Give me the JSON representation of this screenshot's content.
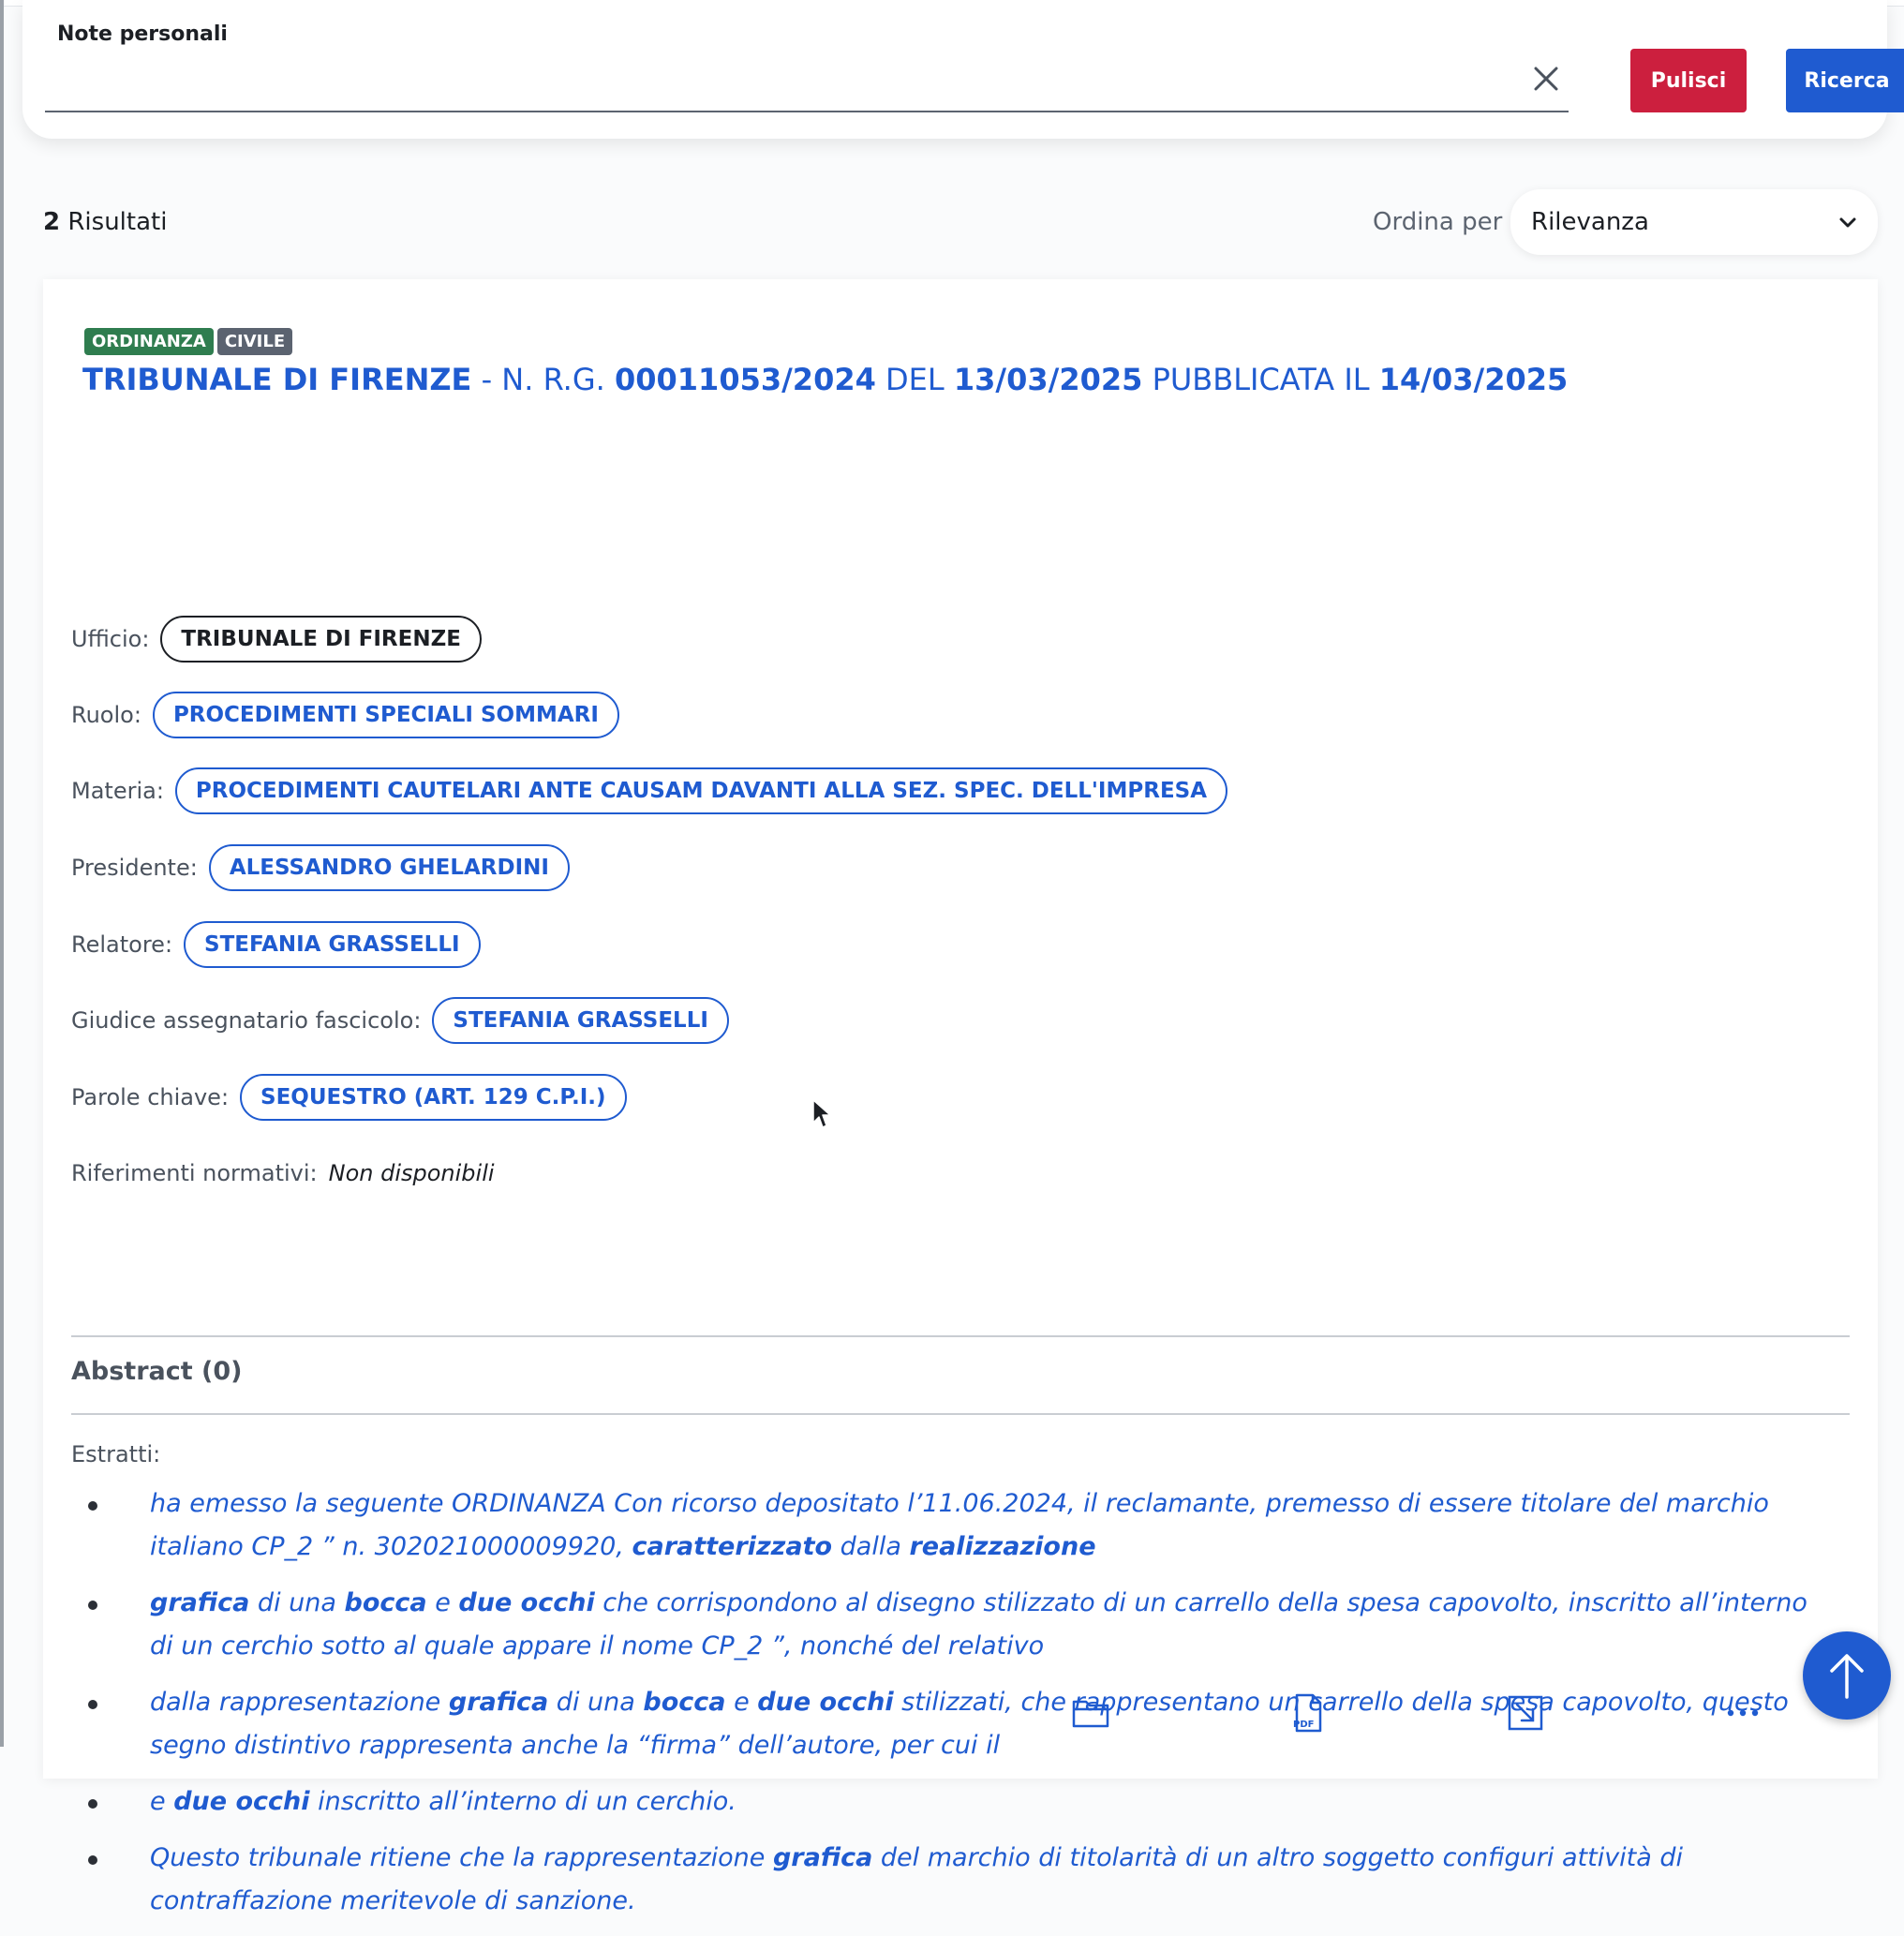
{
  "search": {
    "note_label": "Note personali",
    "note_value": "",
    "clear_label": "Pulisci",
    "search_label": "Ricerca"
  },
  "results": {
    "count": "2",
    "count_label": "Risultati",
    "sort_label": "Ordina per",
    "sort_value": "Rilevanza"
  },
  "colors": {
    "primary": "#1f5bd0",
    "danger": "#cc1f3e",
    "badge_green": "#2f7d4f",
    "badge_gray": "#5b6370"
  },
  "result": {
    "badges": [
      "ORDINANZA",
      "CIVILE"
    ],
    "title": {
      "court": "TRIBUNALE DI FIRENZE",
      "rg_prefix": "- N. R.G.",
      "rg_number": "00011053/2024",
      "del_label": "DEL",
      "date": "13/03/2025",
      "pub_label": "PUBBLICATA IL",
      "pub_date": "14/03/2025"
    },
    "fields": {
      "ufficio_label": "Ufficio:",
      "ufficio": "TRIBUNALE DI FIRENZE",
      "ruolo_label": "Ruolo:",
      "ruolo": "PROCEDIMENTI SPECIALI SOMMARI",
      "materia_label": "Materia:",
      "materia": "PROCEDIMENTI CAUTELARI ANTE CAUSAM DAVANTI ALLA SEZ. SPEC. DELL'IMPRESA",
      "presidente_label": "Presidente:",
      "presidente": "ALESSANDRO GHELARDINI",
      "relatore_label": "Relatore:",
      "relatore": "STEFANIA GRASSELLI",
      "giudice_label": "Giudice assegnatario fascicolo:",
      "giudice": "STEFANIA GRASSELLI",
      "parole_label": "Parole chiave:",
      "parole": "SEQUESTRO (ART. 129 C.P.I.)",
      "riferimenti_label": "Riferimenti normativi:",
      "riferimenti": "Non disponibili"
    },
    "abstract_label": "Abstract (0)",
    "estratti_label": "Estratti:",
    "extracts": [
      [
        {
          "t": "ha emesso la seguente ORDINANZA Con ricorso depositato l’11.06.2024, il reclamante, premesso di essere titolare del marchio italiano CP_2 ” n. 302021000009920, ",
          "b": false
        },
        {
          "t": "caratterizzato",
          "b": true
        },
        {
          "t": " dalla ",
          "b": false
        },
        {
          "t": "realizzazione",
          "b": true
        }
      ],
      [
        {
          "t": "grafica",
          "b": true
        },
        {
          "t": " di una ",
          "b": false
        },
        {
          "t": "bocca",
          "b": true
        },
        {
          "t": " e ",
          "b": false
        },
        {
          "t": "due occhi",
          "b": true
        },
        {
          "t": " che corrispondono al disegno stilizzato di un carrello della spesa capovolto, inscritto all’interno di un cerchio sotto al quale appare il nome CP_2 ”, nonché del relativo",
          "b": false
        }
      ],
      [
        {
          "t": "dalla rappresentazione ",
          "b": false
        },
        {
          "t": "grafica",
          "b": true
        },
        {
          "t": " di una ",
          "b": false
        },
        {
          "t": "bocca",
          "b": true
        },
        {
          "t": " e ",
          "b": false
        },
        {
          "t": "due occhi",
          "b": true
        },
        {
          "t": " stilizzati, che rappresentano un carrello della spesa capovolto, questo segno distintivo rappresenta anche la “firma” dell’autore, per cui il",
          "b": false
        }
      ],
      [
        {
          "t": "e ",
          "b": false
        },
        {
          "t": "due occhi",
          "b": true
        },
        {
          "t": " inscritto all’interno di un cerchio.",
          "b": false
        }
      ],
      [
        {
          "t": "Questo tribunale ritiene che la rappresentazione ",
          "b": false
        },
        {
          "t": "grafica",
          "b": true
        },
        {
          "t": " del marchio di titolarità di un altro soggetto configuri attività di contraffazione meritevole di sanzione.",
          "b": false
        }
      ]
    ],
    "actions": [
      "folder-icon",
      "pdf-icon",
      "open-external-icon",
      "more-icon"
    ],
    "pdf_icon_text": "PDF"
  }
}
